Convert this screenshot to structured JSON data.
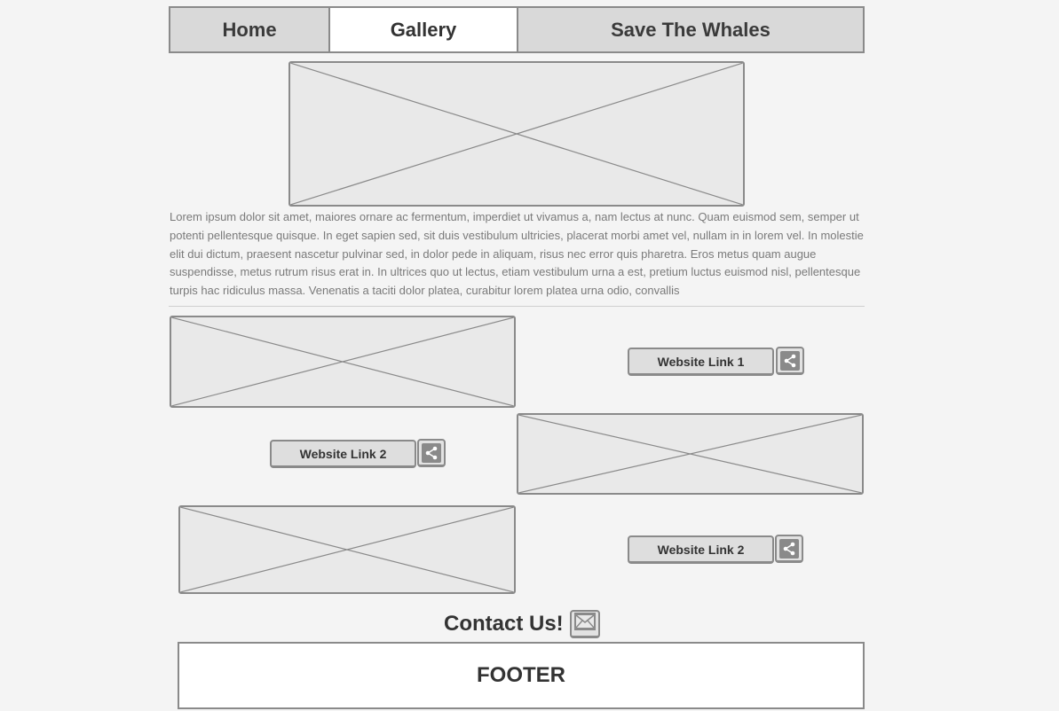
{
  "nav": {
    "tabs": [
      {
        "label": "Home"
      },
      {
        "label": "Gallery"
      },
      {
        "label": "Save The Whales"
      }
    ],
    "active_tab": "Gallery"
  },
  "content": {
    "paragraph": "Lorem ipsum dolor sit amet, maiores ornare ac fermentum, imperdiet ut vivamus a, nam lectus at nunc. Quam euismod sem, semper ut potenti pellentesque quisque. In eget sapien sed, sit duis vestibulum ultricies, placerat morbi amet vel, nullam in in lorem vel. In molestie elit dui dictum, praesent nascetur pulvinar sed, in dolor pede in aliquam, risus nec error quis pharetra. Eros metus quam augue suspendisse, metus rutrum risus erat in.  In ultrices quo ut lectus, etiam vestibulum urna a est, pretium luctus euismod nisl, pellentesque turpis hac ridiculus massa. Venenatis a taciti dolor platea, curabitur lorem platea urna odio, convallis"
  },
  "links": [
    {
      "label": "Website Link 1",
      "icon": "share-icon"
    },
    {
      "label": "Website Link 2",
      "icon": "share-icon"
    },
    {
      "label": "Website Link 2",
      "icon": "share-icon"
    }
  ],
  "contact": {
    "label": "Contact Us!",
    "icon": "mail-icon"
  },
  "footer": {
    "label": "FOOTER"
  },
  "colors": {
    "background": "#f4f4f4",
    "border": "#8a8a8a",
    "placeholder_fill": "#e9e9e9",
    "nav_fill": "#d9d9d9",
    "active_tab_fill": "#ffffff"
  }
}
